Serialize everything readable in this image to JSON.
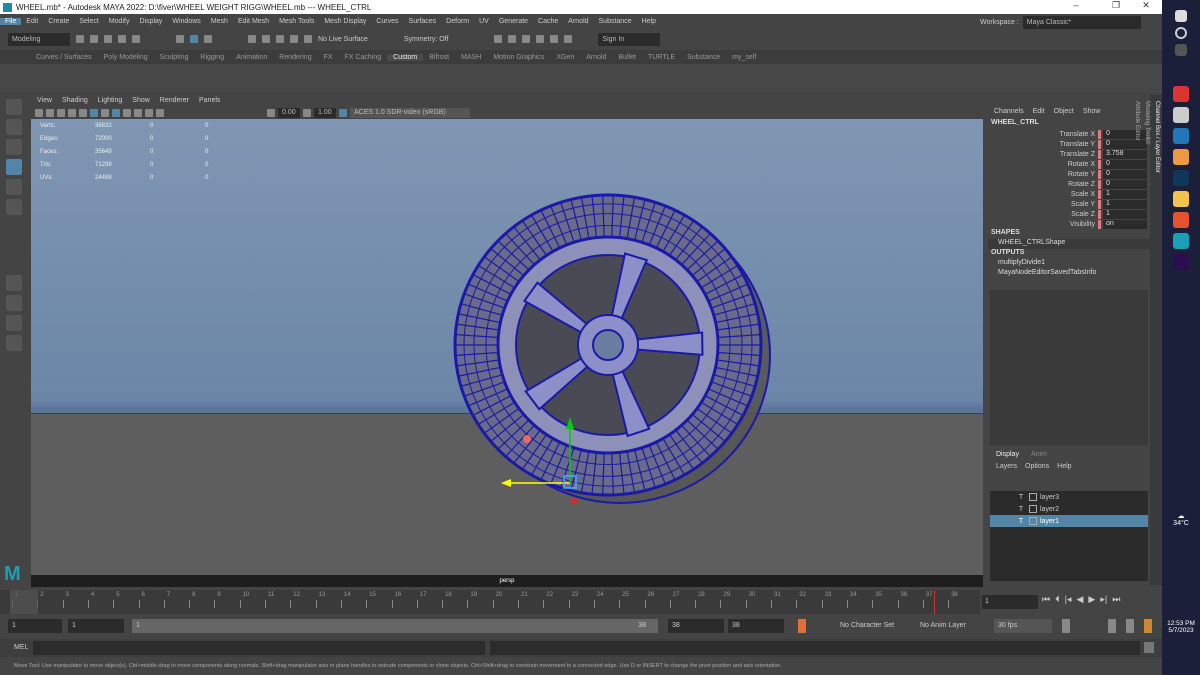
{
  "window": {
    "title": "WHEEL.mb* - Autodesk MAYA 2022: D:\\fiver\\WHEEL WEIGHT RIGG\\WHEEL.mb  ---  WHEEL_CTRL"
  },
  "menu": [
    "File",
    "Edit",
    "Create",
    "Select",
    "Modify",
    "Display",
    "Windows",
    "Mesh",
    "Edit Mesh",
    "Mesh Tools",
    "Mesh Display",
    "Curves",
    "Surfaces",
    "Deform",
    "UV",
    "Generate",
    "Cache",
    "Arnold",
    "Substance",
    "Help"
  ],
  "workspace": {
    "label": "Workspace :",
    "value": "Maya Classic*"
  },
  "toolbar": {
    "mode": "Modeling",
    "live_surface": "No Live Surface",
    "symmetry": "Symmetry: Off",
    "sign_in": "Sign In"
  },
  "shelf_tabs": [
    "Curves / Surfaces",
    "Poly Modeling",
    "Sculpting",
    "Rigging",
    "Animation",
    "Rendering",
    "FX",
    "FX Caching",
    "Custom",
    "Bifrost",
    "MASH",
    "Motion Graphics",
    "XGen",
    "Arnold",
    "Bullet",
    "TURTLE",
    "Substance",
    "my_self"
  ],
  "shelf_active": "Custom",
  "viewport": {
    "menu": [
      "View",
      "Shading",
      "Lighting",
      "Show",
      "Renderer",
      "Panels"
    ],
    "exposure": "0.00",
    "gamma": "1.00",
    "color_space": "ACES 1.0 SDR-video (sRGB)",
    "camera": "persp",
    "hud": [
      [
        "Verts:",
        "36832",
        "0",
        "0"
      ],
      [
        "Edges:",
        "72000",
        "0",
        "0"
      ],
      [
        "Faces:",
        "35649",
        "0",
        "0"
      ],
      [
        "Tris:",
        "71298",
        "0",
        "0"
      ],
      [
        "UVs:",
        "24488",
        "0",
        "0"
      ]
    ]
  },
  "channel_box": {
    "tabs": [
      "Channels",
      "Edit",
      "Object",
      "Show"
    ],
    "object": "WHEEL_CTRL",
    "attrs": [
      [
        "Translate X",
        "0"
      ],
      [
        "Translate Y",
        "0"
      ],
      [
        "Translate Z",
        "3.758"
      ],
      [
        "Rotate X",
        "0"
      ],
      [
        "Rotate Y",
        "0"
      ],
      [
        "Rotate Z",
        "0"
      ],
      [
        "Scale X",
        "1"
      ],
      [
        "Scale Y",
        "1"
      ],
      [
        "Scale Z",
        "1"
      ],
      [
        "Visibility",
        "on"
      ]
    ],
    "shapes_label": "SHAPES",
    "shape": "WHEEL_CTRLShape",
    "outputs_label": "OUTPUTS",
    "outputs": [
      "multiplyDivide1",
      "MayaNodeEditorSavedTabsInfo"
    ]
  },
  "side_tabs": [
    "Channel Box / Layer Editor",
    "Modeling Toolkit",
    "Attribute Editor"
  ],
  "layers": {
    "tabs": [
      "Display",
      "Anim"
    ],
    "menu": [
      "Layers",
      "Options",
      "Help"
    ],
    "items": [
      {
        "name": "layer3",
        "selected": false
      },
      {
        "name": "layer2",
        "selected": false
      },
      {
        "name": "layer1",
        "selected": true
      }
    ]
  },
  "timeline": {
    "ticks": [
      "1",
      "2",
      "3",
      "4",
      "5",
      "6",
      "7",
      "8",
      "9",
      "10",
      "11",
      "12",
      "13",
      "14",
      "15",
      "16",
      "17",
      "18",
      "19",
      "20",
      "21",
      "22",
      "23",
      "24",
      "25",
      "26",
      "27",
      "28",
      "29",
      "30",
      "31",
      "32",
      "33",
      "34",
      "35",
      "36",
      "37",
      "38"
    ],
    "current": "1",
    "current_field": "1"
  },
  "range": {
    "start": "1",
    "play_start": "1",
    "slider_start": "1",
    "slider_end": "38",
    "play_end": "38",
    "end": "38",
    "character_set": "No Character Set",
    "anim_layer": "No Anim Layer",
    "fps": "30 fps"
  },
  "mel": {
    "label": "MEL"
  },
  "help_line": "Move Tool: Use manipulator to move object(s). Ctrl+middle-drag to move components along normals. Shift+drag manipulator axis or plane handles to extrude components or clone objects. Ctrl+Shift+drag to constrain movement to a connected edge. Use D or INSERT to change the pivot position and axis orientation.",
  "taskbar": {
    "weather": "34°C",
    "time": "12:53 PM",
    "date": "5/7/2023"
  },
  "colors": {
    "accent": "#5285a6",
    "wireframe": "#1a1aa8",
    "taskbar": "#1c1f3a"
  }
}
